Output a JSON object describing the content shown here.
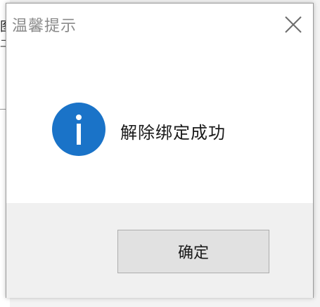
{
  "dialog": {
    "title": "温馨提示",
    "message": "解除绑定成功",
    "ok_label": "确定",
    "icon": "info-icon",
    "close_icon": "close-icon"
  },
  "background_window": {
    "glyph_1": "图",
    "glyph_2": "二"
  },
  "colors": {
    "info_icon_fill": "#1a73c8",
    "button_bg": "#e1e1e1",
    "footer_bg": "#f0f0f0",
    "title_text": "#8a8a8a"
  }
}
